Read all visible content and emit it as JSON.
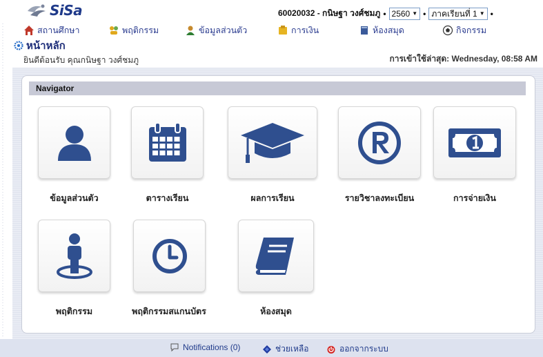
{
  "header": {
    "logo_text": "SiSa",
    "user": "60020032 - กนิษฐา วงศ์ชมภู",
    "year_select": "2560",
    "term_select": "ภาคเรียนที่ 1",
    "sep": "•"
  },
  "menu": [
    {
      "label": "สถานศึกษา",
      "icon": "home-icon"
    },
    {
      "label": "พฤติกรรม",
      "icon": "behavior-icon"
    },
    {
      "label": "ข้อมูลส่วนตัว",
      "icon": "profile-icon"
    },
    {
      "label": "การเงิน",
      "icon": "money-icon"
    },
    {
      "label": "ห้องสมุด",
      "icon": "library-icon"
    },
    {
      "label": "กิจกรรม",
      "icon": "activity-icon"
    }
  ],
  "page": {
    "title": "หน้าหลัก",
    "welcome": "ยินดีต้อนรับ คุณกนิษฐา วงศ์ชมภู",
    "last_login": "การเข้าใช้ล่าสุด: Wednesday, 08:58 AM"
  },
  "navigator": {
    "title": "Navigator",
    "tiles": [
      {
        "label": "ข้อมูลส่วนตัว",
        "icon": "user-icon"
      },
      {
        "label": "ตารางเรียน",
        "icon": "calendar-icon"
      },
      {
        "label": "ผลการเรียน",
        "icon": "graduation-cap-icon"
      },
      {
        "label": "รายวิชาลงทะเบียน",
        "icon": "registered-icon"
      },
      {
        "label": "การจ่ายเงิน",
        "icon": "banknote-icon"
      },
      {
        "label": "พฤติกรรม",
        "icon": "person-pin-icon"
      },
      {
        "label": "พฤติกรรมสแกนบัตร",
        "icon": "clock-icon"
      },
      {
        "label": "ห้องสมุด",
        "icon": "book-icon"
      }
    ]
  },
  "footer": {
    "notifications": "Notifications (0)",
    "help": "ช่วยเหลือ",
    "logout": "ออกจากระบบ"
  },
  "colors": {
    "icon_blue": "#2f4f8f",
    "brand_navy": "#1f3a8a",
    "nav_header_bg": "#c7c9d6",
    "footer_bg": "#dde2ef",
    "logout_red": "#d4231f"
  }
}
